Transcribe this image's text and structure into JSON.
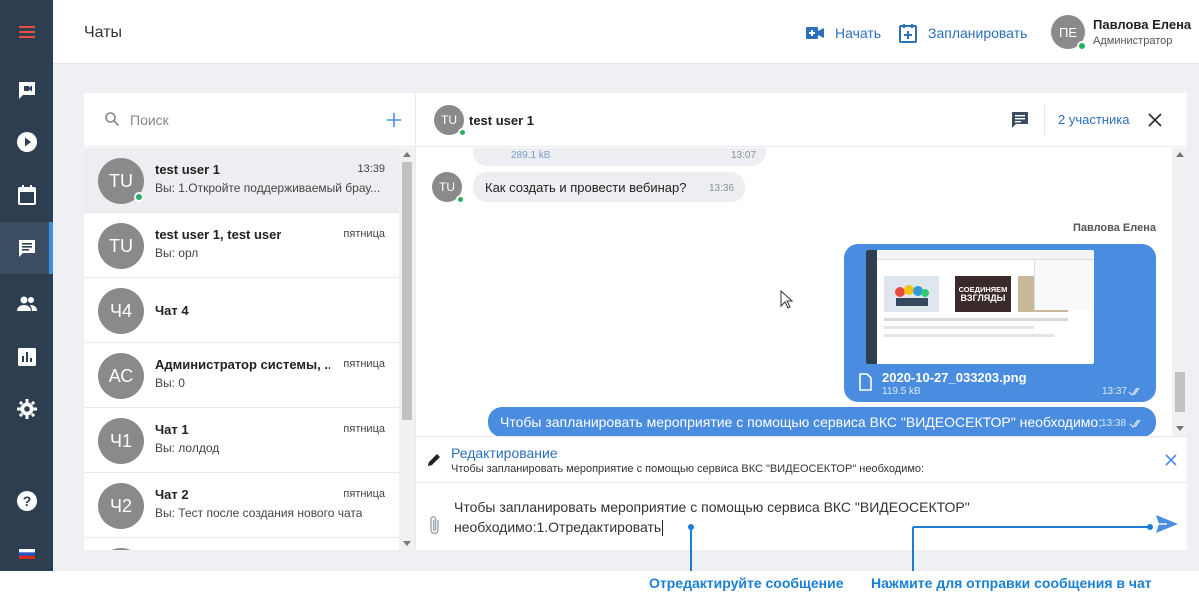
{
  "header": {
    "title": "Чаты",
    "start_label": "Начать",
    "schedule_label": "Запланировать",
    "user": {
      "initials": "ПЕ",
      "name": "Павлова Елена",
      "role": "Администратор"
    }
  },
  "sidebar": {
    "items": [
      {
        "icon": "menu-icon"
      },
      {
        "icon": "video-chat-icon"
      },
      {
        "icon": "play-icon"
      },
      {
        "icon": "calendar-icon"
      },
      {
        "icon": "chat-icon",
        "active": true
      },
      {
        "icon": "people-icon"
      },
      {
        "icon": "chart-icon"
      },
      {
        "icon": "gear-icon"
      },
      {
        "icon": "help-icon"
      },
      {
        "icon": "flag-ru-icon"
      }
    ]
  },
  "chat_list": {
    "search_placeholder": "Поиск",
    "items": [
      {
        "initials": "TU",
        "name": "test user 1",
        "time": "13:39",
        "preview": "Вы: 1.Откройте поддерживаемый брау...",
        "online": true
      },
      {
        "initials": "TU",
        "name": "test user 1, test user",
        "time": "пятница",
        "preview": "Вы: орл"
      },
      {
        "initials": "Ч4",
        "name": "Чат 4",
        "time": "",
        "preview": ""
      },
      {
        "initials": "АС",
        "name": "Администратор системы, ...",
        "time": "пятница",
        "preview": "Вы: 0"
      },
      {
        "initials": "Ч1",
        "name": "Чат 1",
        "time": "пятница",
        "preview": "Вы: лолдод"
      },
      {
        "initials": "Ч2",
        "name": "Чат 2",
        "time": "пятница",
        "preview": "Вы: Тест после создания нового чата"
      }
    ]
  },
  "conversation": {
    "initials": "TU",
    "title": "test user 1",
    "participants": "2 участника",
    "messages": {
      "partial_size": "289.1 kB",
      "partial_time": "13:07",
      "question_initials": "TU",
      "question_text": "Как создать и провести вебинар?",
      "question_time": "13:36",
      "sender_name": "Павлова Елена",
      "image_caption_left": "СОЕДИНЯЕМ",
      "image_caption_right": "ВЗГЛЯДЫ",
      "file_name": "2020-10-27_033203.png",
      "file_size": "119.5 kB",
      "file_time": "13:37",
      "last_text": "Чтобы запланировать мероприятие с помощью сервиса ВКС \"ВИДЕОСЕКТОР\" необходимо:",
      "last_time": "13:38"
    },
    "edit": {
      "title": "Редактирование",
      "quote": "Чтобы запланировать мероприятие с помощью сервиса ВКС \"ВИДЕОСЕКТОР\" необходимо:"
    },
    "compose": {
      "line1": "Чтобы запланировать мероприятие с помощью сервиса ВКС \"ВИДЕОСЕКТОР\"",
      "line2": "необходимо:1.Отредактировать"
    }
  },
  "annotations": {
    "edit_hint": "Отредактируйте сообщение",
    "send_hint": "Нажмите для отправки сообщения в чат"
  },
  "colors": {
    "accent": "#2c6fbd",
    "rail": "#2c3e50",
    "bubble_out": "#4a8de0",
    "online": "#27ae60",
    "callout": "#1a7fd4"
  }
}
